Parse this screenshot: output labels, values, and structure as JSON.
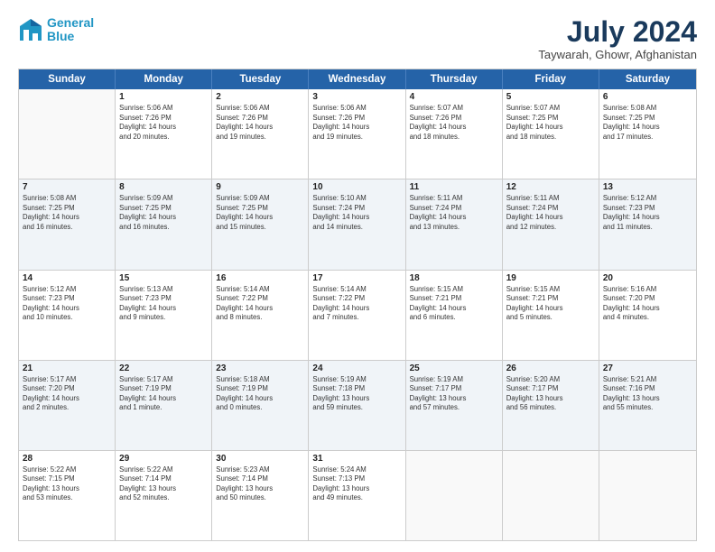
{
  "header": {
    "logo_line1": "General",
    "logo_line2": "Blue",
    "month_year": "July 2024",
    "location": "Taywarah, Ghowr, Afghanistan"
  },
  "days_of_week": [
    "Sunday",
    "Monday",
    "Tuesday",
    "Wednesday",
    "Thursday",
    "Friday",
    "Saturday"
  ],
  "weeks": [
    [
      {
        "day": "",
        "info": ""
      },
      {
        "day": "1",
        "info": "Sunrise: 5:06 AM\nSunset: 7:26 PM\nDaylight: 14 hours\nand 20 minutes."
      },
      {
        "day": "2",
        "info": "Sunrise: 5:06 AM\nSunset: 7:26 PM\nDaylight: 14 hours\nand 19 minutes."
      },
      {
        "day": "3",
        "info": "Sunrise: 5:06 AM\nSunset: 7:26 PM\nDaylight: 14 hours\nand 19 minutes."
      },
      {
        "day": "4",
        "info": "Sunrise: 5:07 AM\nSunset: 7:26 PM\nDaylight: 14 hours\nand 18 minutes."
      },
      {
        "day": "5",
        "info": "Sunrise: 5:07 AM\nSunset: 7:25 PM\nDaylight: 14 hours\nand 18 minutes."
      },
      {
        "day": "6",
        "info": "Sunrise: 5:08 AM\nSunset: 7:25 PM\nDaylight: 14 hours\nand 17 minutes."
      }
    ],
    [
      {
        "day": "7",
        "info": "Sunrise: 5:08 AM\nSunset: 7:25 PM\nDaylight: 14 hours\nand 16 minutes."
      },
      {
        "day": "8",
        "info": "Sunrise: 5:09 AM\nSunset: 7:25 PM\nDaylight: 14 hours\nand 16 minutes."
      },
      {
        "day": "9",
        "info": "Sunrise: 5:09 AM\nSunset: 7:25 PM\nDaylight: 14 hours\nand 15 minutes."
      },
      {
        "day": "10",
        "info": "Sunrise: 5:10 AM\nSunset: 7:24 PM\nDaylight: 14 hours\nand 14 minutes."
      },
      {
        "day": "11",
        "info": "Sunrise: 5:11 AM\nSunset: 7:24 PM\nDaylight: 14 hours\nand 13 minutes."
      },
      {
        "day": "12",
        "info": "Sunrise: 5:11 AM\nSunset: 7:24 PM\nDaylight: 14 hours\nand 12 minutes."
      },
      {
        "day": "13",
        "info": "Sunrise: 5:12 AM\nSunset: 7:23 PM\nDaylight: 14 hours\nand 11 minutes."
      }
    ],
    [
      {
        "day": "14",
        "info": "Sunrise: 5:12 AM\nSunset: 7:23 PM\nDaylight: 14 hours\nand 10 minutes."
      },
      {
        "day": "15",
        "info": "Sunrise: 5:13 AM\nSunset: 7:23 PM\nDaylight: 14 hours\nand 9 minutes."
      },
      {
        "day": "16",
        "info": "Sunrise: 5:14 AM\nSunset: 7:22 PM\nDaylight: 14 hours\nand 8 minutes."
      },
      {
        "day": "17",
        "info": "Sunrise: 5:14 AM\nSunset: 7:22 PM\nDaylight: 14 hours\nand 7 minutes."
      },
      {
        "day": "18",
        "info": "Sunrise: 5:15 AM\nSunset: 7:21 PM\nDaylight: 14 hours\nand 6 minutes."
      },
      {
        "day": "19",
        "info": "Sunrise: 5:15 AM\nSunset: 7:21 PM\nDaylight: 14 hours\nand 5 minutes."
      },
      {
        "day": "20",
        "info": "Sunrise: 5:16 AM\nSunset: 7:20 PM\nDaylight: 14 hours\nand 4 minutes."
      }
    ],
    [
      {
        "day": "21",
        "info": "Sunrise: 5:17 AM\nSunset: 7:20 PM\nDaylight: 14 hours\nand 2 minutes."
      },
      {
        "day": "22",
        "info": "Sunrise: 5:17 AM\nSunset: 7:19 PM\nDaylight: 14 hours\nand 1 minute."
      },
      {
        "day": "23",
        "info": "Sunrise: 5:18 AM\nSunset: 7:19 PM\nDaylight: 14 hours\nand 0 minutes."
      },
      {
        "day": "24",
        "info": "Sunrise: 5:19 AM\nSunset: 7:18 PM\nDaylight: 13 hours\nand 59 minutes."
      },
      {
        "day": "25",
        "info": "Sunrise: 5:19 AM\nSunset: 7:17 PM\nDaylight: 13 hours\nand 57 minutes."
      },
      {
        "day": "26",
        "info": "Sunrise: 5:20 AM\nSunset: 7:17 PM\nDaylight: 13 hours\nand 56 minutes."
      },
      {
        "day": "27",
        "info": "Sunrise: 5:21 AM\nSunset: 7:16 PM\nDaylight: 13 hours\nand 55 minutes."
      }
    ],
    [
      {
        "day": "28",
        "info": "Sunrise: 5:22 AM\nSunset: 7:15 PM\nDaylight: 13 hours\nand 53 minutes."
      },
      {
        "day": "29",
        "info": "Sunrise: 5:22 AM\nSunset: 7:14 PM\nDaylight: 13 hours\nand 52 minutes."
      },
      {
        "day": "30",
        "info": "Sunrise: 5:23 AM\nSunset: 7:14 PM\nDaylight: 13 hours\nand 50 minutes."
      },
      {
        "day": "31",
        "info": "Sunrise: 5:24 AM\nSunset: 7:13 PM\nDaylight: 13 hours\nand 49 minutes."
      },
      {
        "day": "",
        "info": ""
      },
      {
        "day": "",
        "info": ""
      },
      {
        "day": "",
        "info": ""
      }
    ]
  ]
}
